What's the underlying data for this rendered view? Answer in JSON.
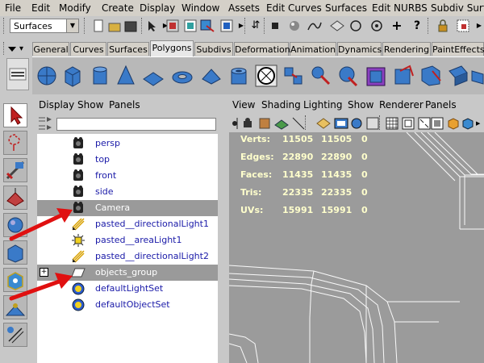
{
  "menubar": [
    "File",
    "Edit",
    "Modify",
    "Create",
    "Display",
    "Window",
    "Assets",
    "Edit Curves",
    "Surfaces",
    "Edit NURBS",
    "Subdiv Surfa"
  ],
  "status": {
    "mode_value": "Surfaces"
  },
  "shelf": {
    "tabs": [
      "General",
      "Curves",
      "Surfaces",
      "Polygons",
      "Subdivs",
      "Deformation",
      "Animation",
      "Dynamics",
      "Rendering",
      "PaintEffects"
    ],
    "active_tab": "Polygons"
  },
  "outliner": {
    "menu": [
      "Display",
      "Show",
      "Panels"
    ],
    "filter_value": "",
    "items": [
      {
        "label": "persp",
        "icon": "camera-icon",
        "highlighted": false,
        "expandable": false
      },
      {
        "label": "top",
        "icon": "camera-icon",
        "highlighted": false,
        "expandable": false
      },
      {
        "label": "front",
        "icon": "camera-icon",
        "highlighted": false,
        "expandable": false
      },
      {
        "label": "side",
        "icon": "camera-icon",
        "highlighted": false,
        "expandable": false
      },
      {
        "label": "Camera",
        "icon": "camera-icon",
        "highlighted": true,
        "expandable": false
      },
      {
        "label": "pasted__directionalLight1",
        "icon": "directional-light-icon",
        "highlighted": false,
        "expandable": false
      },
      {
        "label": "pasted__areaLight1",
        "icon": "area-light-icon",
        "highlighted": false,
        "expandable": false
      },
      {
        "label": "pasted__directionalLight2",
        "icon": "directional-light-icon",
        "highlighted": false,
        "expandable": false
      },
      {
        "label": "objects_group",
        "icon": "group-icon",
        "highlighted": true,
        "expandable": true
      },
      {
        "label": "defaultLightSet",
        "icon": "set-icon",
        "highlighted": false,
        "expandable": false
      },
      {
        "label": "defaultObjectSet",
        "icon": "set-icon",
        "highlighted": false,
        "expandable": false
      }
    ]
  },
  "viewport": {
    "menu": [
      "View",
      "Shading",
      "Lighting",
      "Show",
      "Renderer",
      "Panels"
    ],
    "hud": [
      {
        "label": "Verts:",
        "v1": "11505",
        "v2": "11505",
        "v3": "0"
      },
      {
        "label": "Edges:",
        "v1": "22890",
        "v2": "22890",
        "v3": "0"
      },
      {
        "label": "Faces:",
        "v1": "11435",
        "v2": "11435",
        "v3": "0"
      },
      {
        "label": "Tris:",
        "v1": "22335",
        "v2": "22335",
        "v3": "0"
      },
      {
        "label": "UVs:",
        "v1": "15991",
        "v2": "15991",
        "v3": "0"
      }
    ]
  },
  "colors": {
    "annotation_arrow": "#e01010",
    "highlight_row": "#9a9a9a",
    "viewport_bg": "#9b9b9b",
    "hud_text": "#ffffcc"
  }
}
